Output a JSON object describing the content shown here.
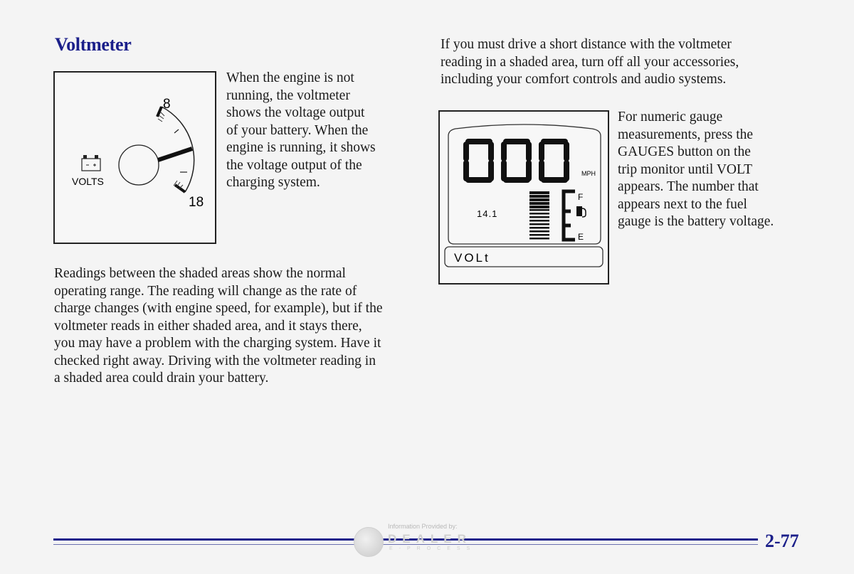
{
  "section_title": "Voltmeter",
  "intro_paragraph": [
    "When the engine is not",
    "running, the voltmeter",
    "shows the voltage output",
    "of your battery. When the",
    "engine is running, it shows",
    "the voltage output of the",
    "charging system."
  ],
  "main_paragraph": [
    "Readings between the shaded areas show the normal",
    "operating range. The reading will change as the rate of",
    "charge changes (with engine speed, for example), but if the",
    "voltmeter reads in either shaded area, and it stays there,",
    "you may have a problem with the charging system. Have it",
    "checked right away. Driving with the voltmeter reading in",
    "a shaded area could drain your battery."
  ],
  "short_distance_paragraph": [
    "If you must drive a short distance with the voltmeter",
    "reading in a shaded area, turn off all your accessories,",
    "including your comfort controls and audio systems."
  ],
  "numeric_paragraph": [
    "For numeric gauge",
    "measurements, press the",
    "GAUGES button on the",
    "trip monitor until VOLT",
    "appears. The number that",
    "appears next to the fuel",
    "gauge is the battery voltage."
  ],
  "voltmeter_gauge": {
    "label": "VOLTS",
    "min_label": "8",
    "max_label": "18",
    "battery_icon": "battery-icon",
    "needle_fraction": 0.5
  },
  "trip_monitor_display": {
    "speed": "000",
    "speed_unit": "MPH",
    "voltage_reading": "14.1",
    "fuel_full_label": "F",
    "fuel_empty_label": "E",
    "fuel_icon": "fuel-pump-icon",
    "message": "VOLt"
  },
  "footer": {
    "page_number": "2-77",
    "watermark_caption": "Information Provided by:",
    "watermark_brand": "DEALER",
    "watermark_sub": "E-PROCESS"
  },
  "colors": {
    "heading": "#1b1f8a",
    "rule": "#1b1f8a"
  }
}
